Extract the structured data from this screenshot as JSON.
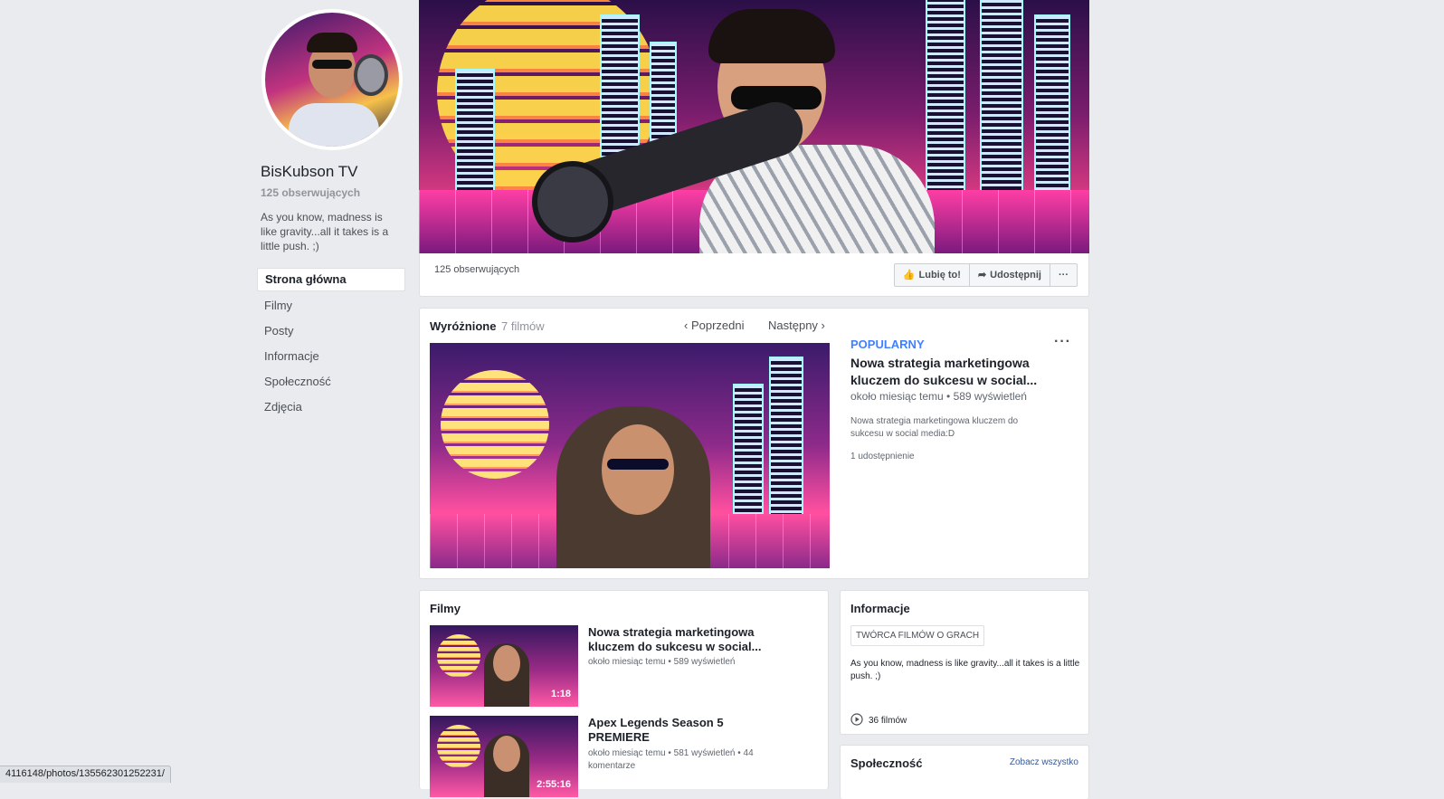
{
  "sidebar": {
    "page_name": "BisKubson TV",
    "followers": "125 obserwujących",
    "about": "As you know, madness is like gravity...all it takes is a little push. ;)",
    "nav": [
      {
        "label": "Strona główna",
        "active": true
      },
      {
        "label": "Filmy"
      },
      {
        "label": "Posty"
      },
      {
        "label": "Informacje"
      },
      {
        "label": "Społeczność"
      },
      {
        "label": "Zdjęcia"
      }
    ]
  },
  "cover_bar": {
    "followers": "125 obserwujących",
    "like_label": "Lubię to!",
    "share_label": "Udostępnij",
    "more_label": "···"
  },
  "featured": {
    "title": "Wyróżnione",
    "count": "7 filmów",
    "prev_label": "Poprzedni",
    "next_label": "Następny",
    "badge": "POPULARNY",
    "more_label": "···",
    "video_title": "Nowa strategia marketingowa kluczem do sukcesu w social...",
    "meta": "około miesiąc temu • 589 wyświetleń",
    "description": "Nowa strategia marketingowa kluczem do sukcesu w social media:D",
    "shares": "1 udostępnienie"
  },
  "videos": {
    "title": "Filmy",
    "items": [
      {
        "title": "Nowa strategia marketingowa kluczem do sukcesu w social...",
        "meta": "około miesiąc temu • 589 wyświetleń",
        "duration": "1:18"
      },
      {
        "title": "Apex Legends Season 5 PREMIERE",
        "meta": "około miesiąc temu • 581 wyświetleń • 44 komentarze",
        "duration": "2:55:16"
      }
    ]
  },
  "info": {
    "title": "Informacje",
    "category": "TWÓRCA FILMÓW O GRACH",
    "about": "As you know, madness is like gravity...all it takes is a little push. ;)",
    "films": "36 filmów"
  },
  "community": {
    "title": "Społeczność",
    "see_all": "Zobacz wszystko"
  },
  "status_url": "4116148/photos/1355623012522​31/",
  "colors": {
    "background": "#e9ebee",
    "link": "#385898",
    "badge": "#4080ff"
  }
}
